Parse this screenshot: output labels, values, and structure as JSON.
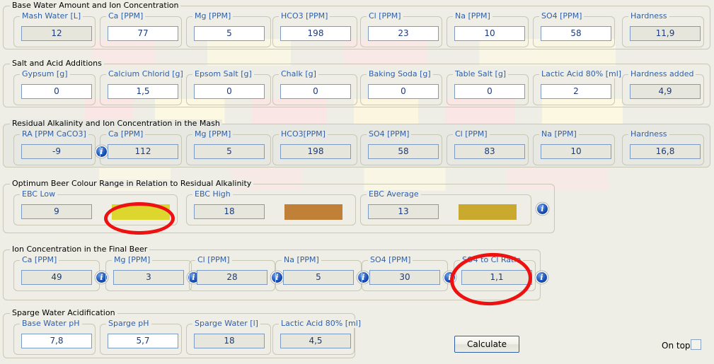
{
  "app": {
    "background_color": "#eeeee6",
    "panel_border_color": "#c8c8b4",
    "label_color": "#2f5fa8",
    "value_color": "#1b3b80",
    "annotation_color": "#ee1111"
  },
  "panels": [
    {
      "title": "Base Water Amount and Ion Concentration",
      "shaded": false,
      "fields": [
        {
          "label": "Mash Water [L]",
          "value": "12",
          "readonly": true,
          "info": false
        },
        {
          "label": "Ca [PPM]",
          "value": "77",
          "readonly": false,
          "info": false
        },
        {
          "label": "Mg [PPM]",
          "value": "5",
          "readonly": false,
          "info": false
        },
        {
          "label": "HCO3 [PPM]",
          "value": "198",
          "readonly": false,
          "info": false
        },
        {
          "label": "Cl [PPM]",
          "value": "23",
          "readonly": false,
          "info": false
        },
        {
          "label": "Na [PPM]",
          "value": "10",
          "readonly": false,
          "info": false
        },
        {
          "label": "SO4 [PPM]",
          "value": "58",
          "readonly": false,
          "info": false
        },
        {
          "label": "Hardness",
          "value": "11,9",
          "readonly": true,
          "info": false
        }
      ]
    },
    {
      "title": "Salt and Acid Additions",
      "shaded": false,
      "fields": [
        {
          "label": "Gypsum [g]",
          "value": "0",
          "readonly": false,
          "info": false
        },
        {
          "label": "Calcium Chlorid [g]",
          "value": "1,5",
          "readonly": false,
          "info": false
        },
        {
          "label": "Epsom Salt [g]",
          "value": "0",
          "readonly": false,
          "info": false
        },
        {
          "label": "Chalk [g]",
          "value": "0",
          "readonly": false,
          "info": false
        },
        {
          "label": "Baking Soda [g]",
          "value": "0",
          "readonly": false,
          "info": false
        },
        {
          "label": "Table Salt [g]",
          "value": "0",
          "readonly": false,
          "info": false
        },
        {
          "label": "Lactic Acid 80% [ml]",
          "value": "2",
          "readonly": false,
          "info": false
        },
        {
          "label": "Hardness added",
          "value": "4,9",
          "readonly": true,
          "info": false
        }
      ]
    },
    {
      "title": "Residual Alkalinity and Ion Concentration in the Mash",
      "shaded": true,
      "fields": [
        {
          "label": "RA [PPM CaCO3]",
          "value": "-9",
          "readonly": true,
          "info": true
        },
        {
          "label": "Ca [PPM]",
          "value": "112",
          "readonly": true,
          "info": false
        },
        {
          "label": "Mg [PPM]",
          "value": "5",
          "readonly": true,
          "info": false
        },
        {
          "label": "HCO3[PPM]",
          "value": "198",
          "readonly": true,
          "info": false
        },
        {
          "label": "SO4 [PPM]",
          "value": "58",
          "readonly": true,
          "info": false
        },
        {
          "label": "Cl [PPM]",
          "value": "83",
          "readonly": true,
          "info": false
        },
        {
          "label": "Na [PPM]",
          "value": "10",
          "readonly": true,
          "info": false
        },
        {
          "label": "Hardness",
          "value": "16,8",
          "readonly": true,
          "info": false
        }
      ]
    },
    {
      "title": "Optimum Beer Colour Range in Relation to Residual Alkalinity",
      "shaded": false,
      "fields": [
        {
          "label": "EBC Low",
          "value": "9",
          "readonly": true,
          "info": false,
          "swatch": "#dcd62e"
        },
        {
          "label": "EBC High",
          "value": "18",
          "readonly": true,
          "info": false,
          "swatch": "#c08038"
        },
        {
          "label": "EBC Average",
          "value": "13",
          "readonly": true,
          "info": false,
          "swatch": "#c9a92e"
        }
      ],
      "trailing_info": true
    },
    {
      "title": "Ion Concentration in the Final Beer",
      "shaded": false,
      "fields": [
        {
          "label": "Ca [PPM]",
          "value": "49",
          "readonly": true,
          "info": true
        },
        {
          "label": "Mg [PPM]",
          "value": "3",
          "readonly": true,
          "info": true
        },
        {
          "label": "Cl [PPM]",
          "value": "28",
          "readonly": true,
          "info": true
        },
        {
          "label": "Na [PPM]",
          "value": "5",
          "readonly": true,
          "info": true
        },
        {
          "label": "SO4 [PPM]",
          "value": "30",
          "readonly": true,
          "info": true
        },
        {
          "label": "SO4 to Cl Ratio",
          "value": "1,1",
          "readonly": true,
          "info": true
        }
      ]
    },
    {
      "title": "Sparge Water Acidification",
      "shaded": false,
      "fields": [
        {
          "label": "Base Water pH",
          "value": "7,8",
          "readonly": false,
          "info": false
        },
        {
          "label": "Sparge pH",
          "value": "5,7",
          "readonly": false,
          "info": false
        },
        {
          "label": "Sparge Water [l]",
          "value": "18",
          "readonly": true,
          "info": false
        },
        {
          "label": "Lactic Acid 80% [ml]",
          "value": "4,5",
          "readonly": true,
          "info": false
        }
      ]
    }
  ],
  "controls": {
    "calculate_label": "Calculate",
    "ontop_label": "On top",
    "ontop_checked": false
  },
  "icons": {
    "info_glyph": "i"
  },
  "annotations": [
    {
      "name": "ellipse-ebc-low-swatch",
      "shape": "ellipse",
      "color": "#ee1111"
    },
    {
      "name": "ellipse-so4-to-cl-ratio",
      "shape": "ellipse",
      "color": "#ee1111"
    }
  ]
}
